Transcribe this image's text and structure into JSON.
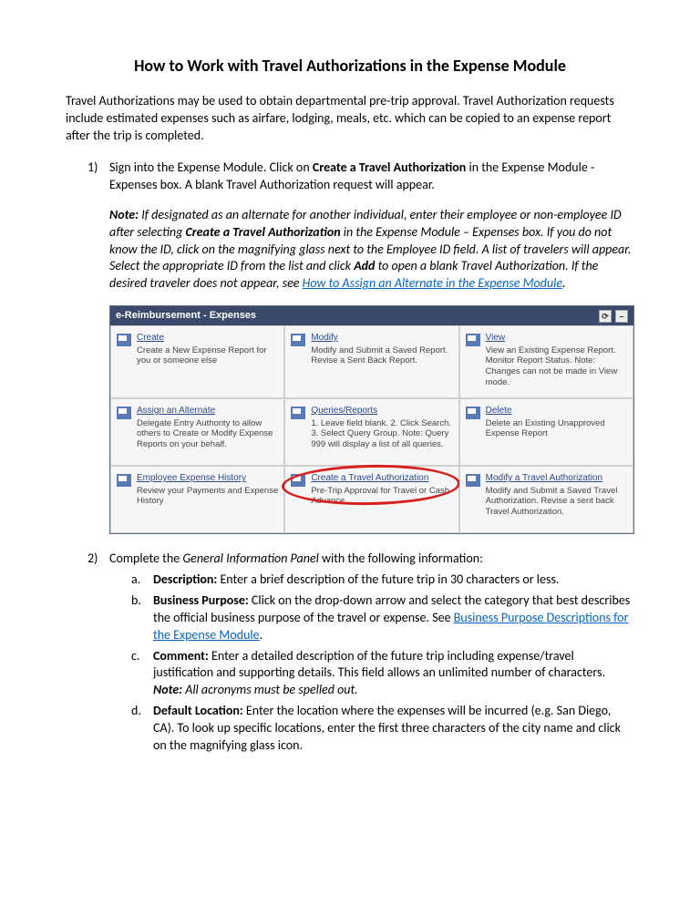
{
  "title": "How to Work with Travel Authorizations in the Expense Module",
  "intro": "Travel Authorizations may be used to obtain departmental pre-trip approval.  Travel Authorization requests include estimated expenses such as airfare, lodging, meals, etc. which can be copied to an expense report after the trip is completed.",
  "step1": {
    "num": "1",
    "text_a": "Sign into the Expense Module.  Click on ",
    "bold_a": "Create a Travel Authorization",
    "text_b": " in the Expense Module - Expenses box.  A blank Travel Authorization request will appear.",
    "note_label": "Note:",
    "note_a": " If designated as an alternate for another individual, enter their employee or non-employee ID after selecting ",
    "note_bold": "Create a Travel Authorization",
    "note_b": " in the Expense Module – Expenses box.  If you do not know the ID, click on the magnifying glass next to the Employee ID field.  A list of travelers will appear.  Select the appropriate ID from the list and click ",
    "note_bold2": "Add",
    "note_c": " to open a blank Travel Authorization.  If the desired traveler does not appear, see  ",
    "note_link": "How to Assign an Alternate in the Expense Module",
    "note_d": "."
  },
  "panel": {
    "header": "e-Reimbursement - Expenses",
    "cells": [
      {
        "title": "Create",
        "desc": "Create a New Expense Report for you or someone else"
      },
      {
        "title": "Modify",
        "desc": "Modify and Submit a Saved Report. Revise a Sent Back Report."
      },
      {
        "title": "View",
        "desc": "View an Existing Expense Report. Monitor Report Status. Note: Changes can not be made in View mode."
      },
      {
        "title": "Assign an Alternate",
        "desc": "Delegate Entry Authority to allow others to Create or Modify Expense Reports on your behalf."
      },
      {
        "title": "Queries/Reports",
        "desc": "1. Leave field blank. 2. Click Search. 3. Select Query Group. Note: Query 999 will display a list of all queries."
      },
      {
        "title": "Delete",
        "desc": "Delete an Existing Unapproved Expense Report"
      },
      {
        "title": "Employee Expense History",
        "desc": "Review your Payments and Expense History"
      },
      {
        "title": "Create a Travel Authorization",
        "desc": "Pre-Trip Approval for Travel or Cash Advance",
        "highlight": true
      },
      {
        "title": "Modify a Travel Authorization",
        "desc": "Modify and Submit a Saved Travel Authorization. Revise a sent back Travel Authorization."
      }
    ]
  },
  "step2": {
    "num": "2",
    "lead_a": "Complete the ",
    "lead_ital": "General Information Panel",
    "lead_b": " with the following information:",
    "items": [
      {
        "num": "a",
        "label": "Description:",
        "text": " Enter a brief description of the future trip in 30 characters or less."
      },
      {
        "num": "b",
        "label": "Business Purpose:",
        "text": " Click on the drop-down arrow and select the category that best describes the official business purpose of the travel or expense.  See  ",
        "link": "Business Purpose Descriptions for the Expense Module",
        "text2": "."
      },
      {
        "num": "c",
        "label": "Comment:",
        "text": " Enter a detailed description of the future trip including expense/travel justification and supporting details.  This field allows an unlimited number of characters. ",
        "note_label": "Note:",
        "note_text": " All acronyms must be spelled out."
      },
      {
        "num": "d",
        "label": "Default Location:",
        "text": " Enter the location where the expenses will be incurred (e.g. San Diego, CA).  To look up specific locations, enter the first three characters of the city name and click on the magnifying glass icon."
      }
    ]
  }
}
